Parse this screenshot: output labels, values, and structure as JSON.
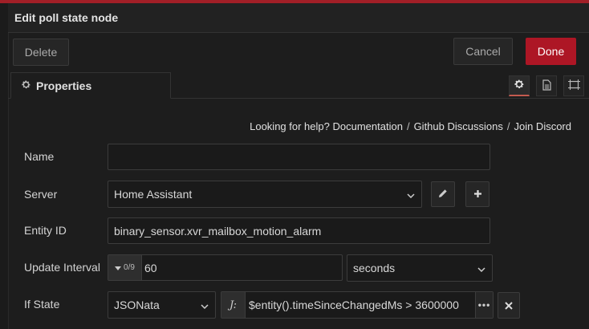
{
  "dialog": {
    "title": "Edit poll state node",
    "delete_label": "Delete",
    "cancel_label": "Cancel",
    "done_label": "Done",
    "colors": {
      "accent": "#ad1625",
      "tab_active_underline": "#c45a4f",
      "background": "#1d1d1d"
    }
  },
  "tabs": {
    "properties_label": "Properties",
    "icons": [
      "gear-icon",
      "document-icon",
      "frame-icon"
    ]
  },
  "help": {
    "prefix": "Looking for help?",
    "links": [
      "Documentation",
      "Github Discussions",
      "Join Discord"
    ],
    "separator": "/"
  },
  "form": {
    "name": {
      "label": "Name",
      "value": ""
    },
    "server": {
      "label": "Server",
      "value": "Home Assistant"
    },
    "entity_id": {
      "label": "Entity ID",
      "value": "binary_sensor.xvr_mailbox_motion_alarm"
    },
    "update_interval": {
      "label": "Update Interval",
      "type_glyph": "0/9",
      "value": "60",
      "units": "seconds"
    },
    "if_state": {
      "label": "If State",
      "type": "JSONata",
      "value": "$entity().timeSinceChangedMs > 3600000",
      "type_glyph": "J:"
    }
  }
}
